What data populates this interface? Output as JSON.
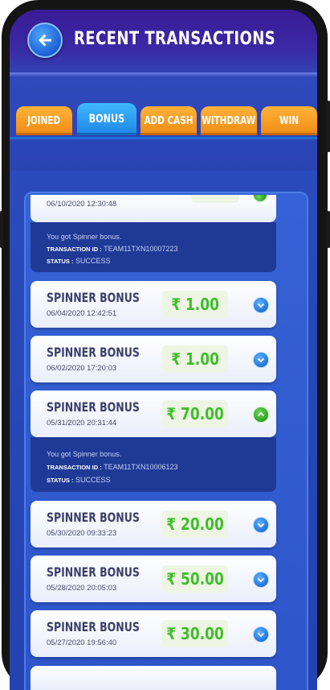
{
  "header": {
    "title": "RECENT TRANSACTIONS"
  },
  "tabs": [
    {
      "label": "JOINED",
      "active": false
    },
    {
      "label": "BONUS",
      "active": true
    },
    {
      "label": "ADD CASH",
      "active": false
    },
    {
      "label": "WITHDRAW",
      "active": false
    },
    {
      "label": "WIN",
      "active": false
    }
  ],
  "labels": {
    "transaction_id": "TRANSACTION ID :",
    "status": "STATUS :"
  },
  "top_partial": {
    "date": "06/10/2020 12:30:48",
    "message": "You got Spinner bonus.",
    "transaction_id": "TEAM11TXN10007223",
    "status": "SUCCESS"
  },
  "transactions": [
    {
      "name": "SPINNER BONUS",
      "date": "06/04/2020 12:42:51",
      "amount": "₹ 1.00",
      "expanded": false
    },
    {
      "name": "SPINNER BONUS",
      "date": "06/02/2020 17:20:03",
      "amount": "₹ 1.00",
      "expanded": false
    },
    {
      "name": "SPINNER BONUS",
      "date": "05/31/2020 20:31:44",
      "amount": "₹ 70.00",
      "expanded": true,
      "message": "You got Spinner bonus.",
      "transaction_id": "TEAM11TXN10006123",
      "status": "SUCCESS"
    },
    {
      "name": "SPINNER BONUS",
      "date": "05/30/2020 09:33:23",
      "amount": "₹ 20.00",
      "expanded": false
    },
    {
      "name": "SPINNER BONUS",
      "date": "05/28/2020 20:05:03",
      "amount": "₹ 50.00",
      "expanded": false
    },
    {
      "name": "SPINNER BONUS",
      "date": "05/27/2020 19:56:40",
      "amount": "₹ 30.00",
      "expanded": false
    }
  ],
  "colors": {
    "header": "#3a1b95",
    "tab_orange": "#f08a12",
    "tab_active": "#1e86e6",
    "amount_green": "#3fbe2c",
    "panel": "#2d55c9"
  },
  "icons": {
    "back": "back-arrow-icon",
    "collapsed": "chevron-down-icon",
    "expanded": "chevron-up-icon"
  }
}
